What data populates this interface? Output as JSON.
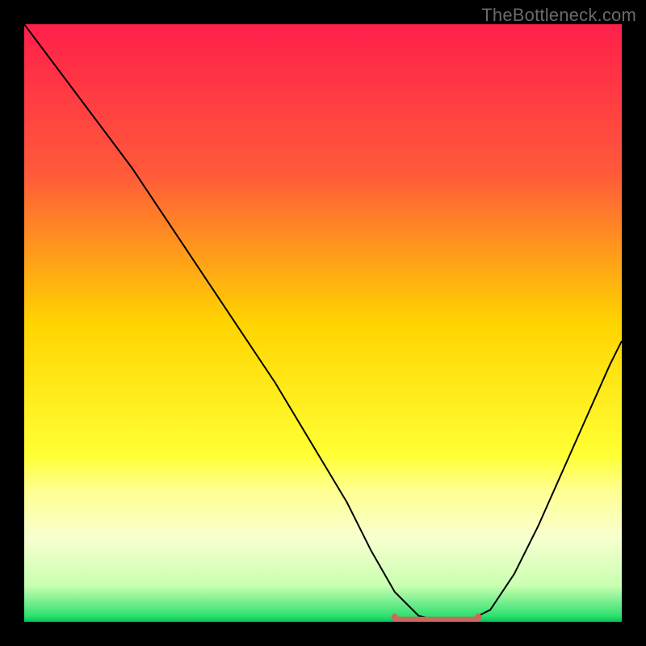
{
  "watermark": "TheBottleneck.com",
  "chart_data": {
    "type": "line",
    "title": "",
    "xlabel": "",
    "ylabel": "",
    "xlim": [
      0,
      100
    ],
    "ylim": [
      0,
      100
    ],
    "background_gradient": {
      "stops": [
        {
          "y": 0,
          "color": "#ff1f4b"
        },
        {
          "y": 25,
          "color": "#ff5a3a"
        },
        {
          "y": 50,
          "color": "#ffd400"
        },
        {
          "y": 72,
          "color": "#ffff33"
        },
        {
          "y": 78,
          "color": "#ffff90"
        },
        {
          "y": 86,
          "color": "#f8ffd0"
        },
        {
          "y": 94,
          "color": "#c8ffb0"
        },
        {
          "y": 99,
          "color": "#30e070"
        },
        {
          "y": 100,
          "color": "#00c853"
        }
      ]
    },
    "series": [
      {
        "name": "bottleneck-curve",
        "color": "#000000",
        "stroke_width": 2,
        "x": [
          0,
          6,
          12,
          18,
          24,
          30,
          36,
          42,
          48,
          54,
          58,
          62,
          66,
          70,
          74,
          78,
          82,
          86,
          90,
          94,
          98,
          100
        ],
        "y": [
          100,
          92,
          84,
          76,
          67,
          58,
          49,
          40,
          30,
          20,
          12,
          5,
          1,
          0,
          0,
          2,
          8,
          16,
          25,
          34,
          43,
          47
        ]
      }
    ],
    "flat_segment": {
      "name": "optimal-range",
      "color": "#c96a5a",
      "stroke_width": 8,
      "linecap": "round",
      "x_start": 62,
      "x_end": 76,
      "y": 0.3
    }
  }
}
